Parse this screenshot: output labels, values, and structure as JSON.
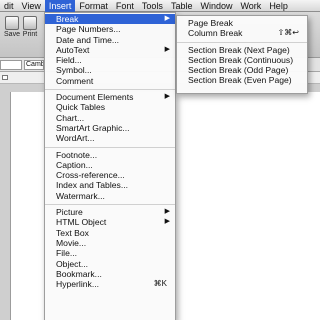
{
  "menubar": {
    "items": [
      "dit",
      "View",
      "Insert",
      "Format",
      "Font",
      "Tools",
      "Table",
      "Window",
      "Work",
      "Help"
    ]
  },
  "toolbar": {
    "save_label": "Save",
    "print_label": "Print",
    "font_value": "Camb"
  },
  "insert_menu": {
    "group1": [
      {
        "label": "Break",
        "submenu": true
      },
      {
        "label": "Page Numbers..."
      },
      {
        "label": "Date and Time..."
      },
      {
        "label": "AutoText",
        "submenu": true
      },
      {
        "label": "Field..."
      },
      {
        "label": "Symbol..."
      },
      {
        "label": "Comment"
      }
    ],
    "group2": [
      {
        "label": "Document Elements",
        "submenu": true
      },
      {
        "label": "Quick Tables"
      },
      {
        "label": "Chart..."
      },
      {
        "label": "SmartArt Graphic..."
      },
      {
        "label": "WordArt..."
      }
    ],
    "group3": [
      {
        "label": "Footnote..."
      },
      {
        "label": "Caption..."
      },
      {
        "label": "Cross-reference..."
      },
      {
        "label": "Index and Tables..."
      },
      {
        "label": "Watermark..."
      }
    ],
    "group4": [
      {
        "label": "Picture",
        "submenu": true
      },
      {
        "label": "HTML Object",
        "submenu": true
      },
      {
        "label": "Text Box"
      },
      {
        "label": "Movie..."
      },
      {
        "label": "File..."
      },
      {
        "label": "Object..."
      },
      {
        "label": "Bookmark..."
      },
      {
        "label": "Hyperlink...",
        "shortcut": "⌘K"
      }
    ]
  },
  "break_menu": {
    "group1": [
      {
        "label": "Page Break"
      },
      {
        "label": "Column Break",
        "shortcut": "⇧⌘↩"
      }
    ],
    "group2": [
      {
        "label": "Section Break (Next Page)"
      },
      {
        "label": "Section Break (Continuous)"
      },
      {
        "label": "Section Break (Odd Page)"
      },
      {
        "label": "Section Break (Even Page)"
      }
    ]
  },
  "icons": {
    "submenu_arrow": "▶"
  },
  "colors": {
    "highlight": "#2f63d6"
  }
}
